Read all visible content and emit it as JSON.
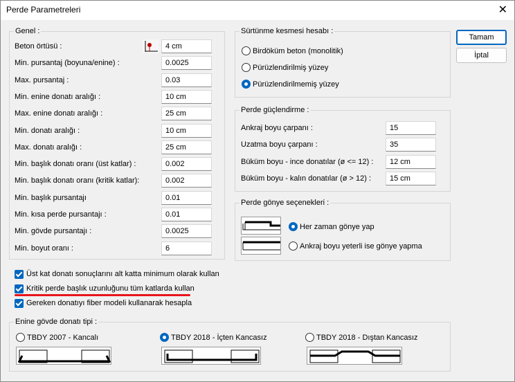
{
  "window": {
    "title": "Perde Parametreleri",
    "close_glyph": "✕"
  },
  "buttons": {
    "ok": "Tamam",
    "cancel": "İptal"
  },
  "genel": {
    "legend": "Genel :",
    "rows": [
      {
        "label": "Beton örtüsü :",
        "value": "4 cm"
      },
      {
        "label": "Min.  pursantaj (boyuna/enine) :",
        "value": "0.0025"
      },
      {
        "label": "Max. pursantaj :",
        "value": "0.03"
      },
      {
        "label": "Min. enine donatı aralığı :",
        "value": "10 cm"
      },
      {
        "label": "Max. enine donatı aralığı :",
        "value": "25 cm"
      },
      {
        "label": "Min. donatı aralığı :",
        "value": "10 cm"
      },
      {
        "label": "Max. donatı aralığı :",
        "value": "25 cm"
      },
      {
        "label": "Min. başlık donatı oranı (üst katlar) :",
        "value": "0.002"
      },
      {
        "label": "Min. başlık donatı oranı (kritik katlar):",
        "value": "0.002"
      },
      {
        "label": "Min. başlık pursantajı",
        "value": "0.01"
      },
      {
        "label": "Min. kısa perde pursantajı :",
        "value": "0.01"
      },
      {
        "label": "Min. gövde pursantajı :",
        "value": "0.0025"
      },
      {
        "label": "Min. boyut oranı :",
        "value": "6"
      }
    ]
  },
  "surtunme": {
    "legend": "Sürtünme kesmesi hesabı :",
    "options": [
      {
        "label": "Birdöküm beton (monolitik)",
        "selected": false
      },
      {
        "label": "Pürüzlendirilmiş yüzey",
        "selected": false
      },
      {
        "label": "Pürüzlendirilmemiş yüzey",
        "selected": true
      }
    ]
  },
  "guclendirme": {
    "legend": "Perde güçlendirme :",
    "rows": [
      {
        "label": "Ankraj boyu çarpanı :",
        "value": "15"
      },
      {
        "label": "Uzatma boyu çarpanı :",
        "value": "35"
      },
      {
        "label": "Büküm boyu - ince donatılar (ø <= 12) :",
        "value": "12 cm"
      },
      {
        "label": "Büküm boyu - kalın donatılar (ø > 12) :",
        "value": "15 cm"
      }
    ]
  },
  "gonye": {
    "legend": "Perde gönye seçenekleri :",
    "options": [
      {
        "label": "Her zaman gönye yap",
        "selected": true
      },
      {
        "label": "Ankraj boyu yeterli ise gönye yapma",
        "selected": false
      }
    ]
  },
  "checks": [
    {
      "label": "Üst kat donatı sonuçlarını alt katta minimum olarak kullan",
      "checked": true
    },
    {
      "label": "Kritik perde başlık uzunluğunu tüm katlarda kullan",
      "checked": true
    },
    {
      "label": "Gereken donatıyı fiber modeli kullanarak hesapla",
      "checked": true
    }
  ],
  "enine": {
    "legend": "Enine gövde donatı tipi :",
    "options": [
      {
        "label": "TBDY 2007 - Kancalı",
        "selected": false
      },
      {
        "label": "TBDY 2018 - İçten Kancasız",
        "selected": true
      },
      {
        "label": "TBDY 2018 - Dıştan Kancasız",
        "selected": false
      }
    ]
  },
  "colors": {
    "accent": "#0067c0",
    "annotation": "#e8141c"
  }
}
